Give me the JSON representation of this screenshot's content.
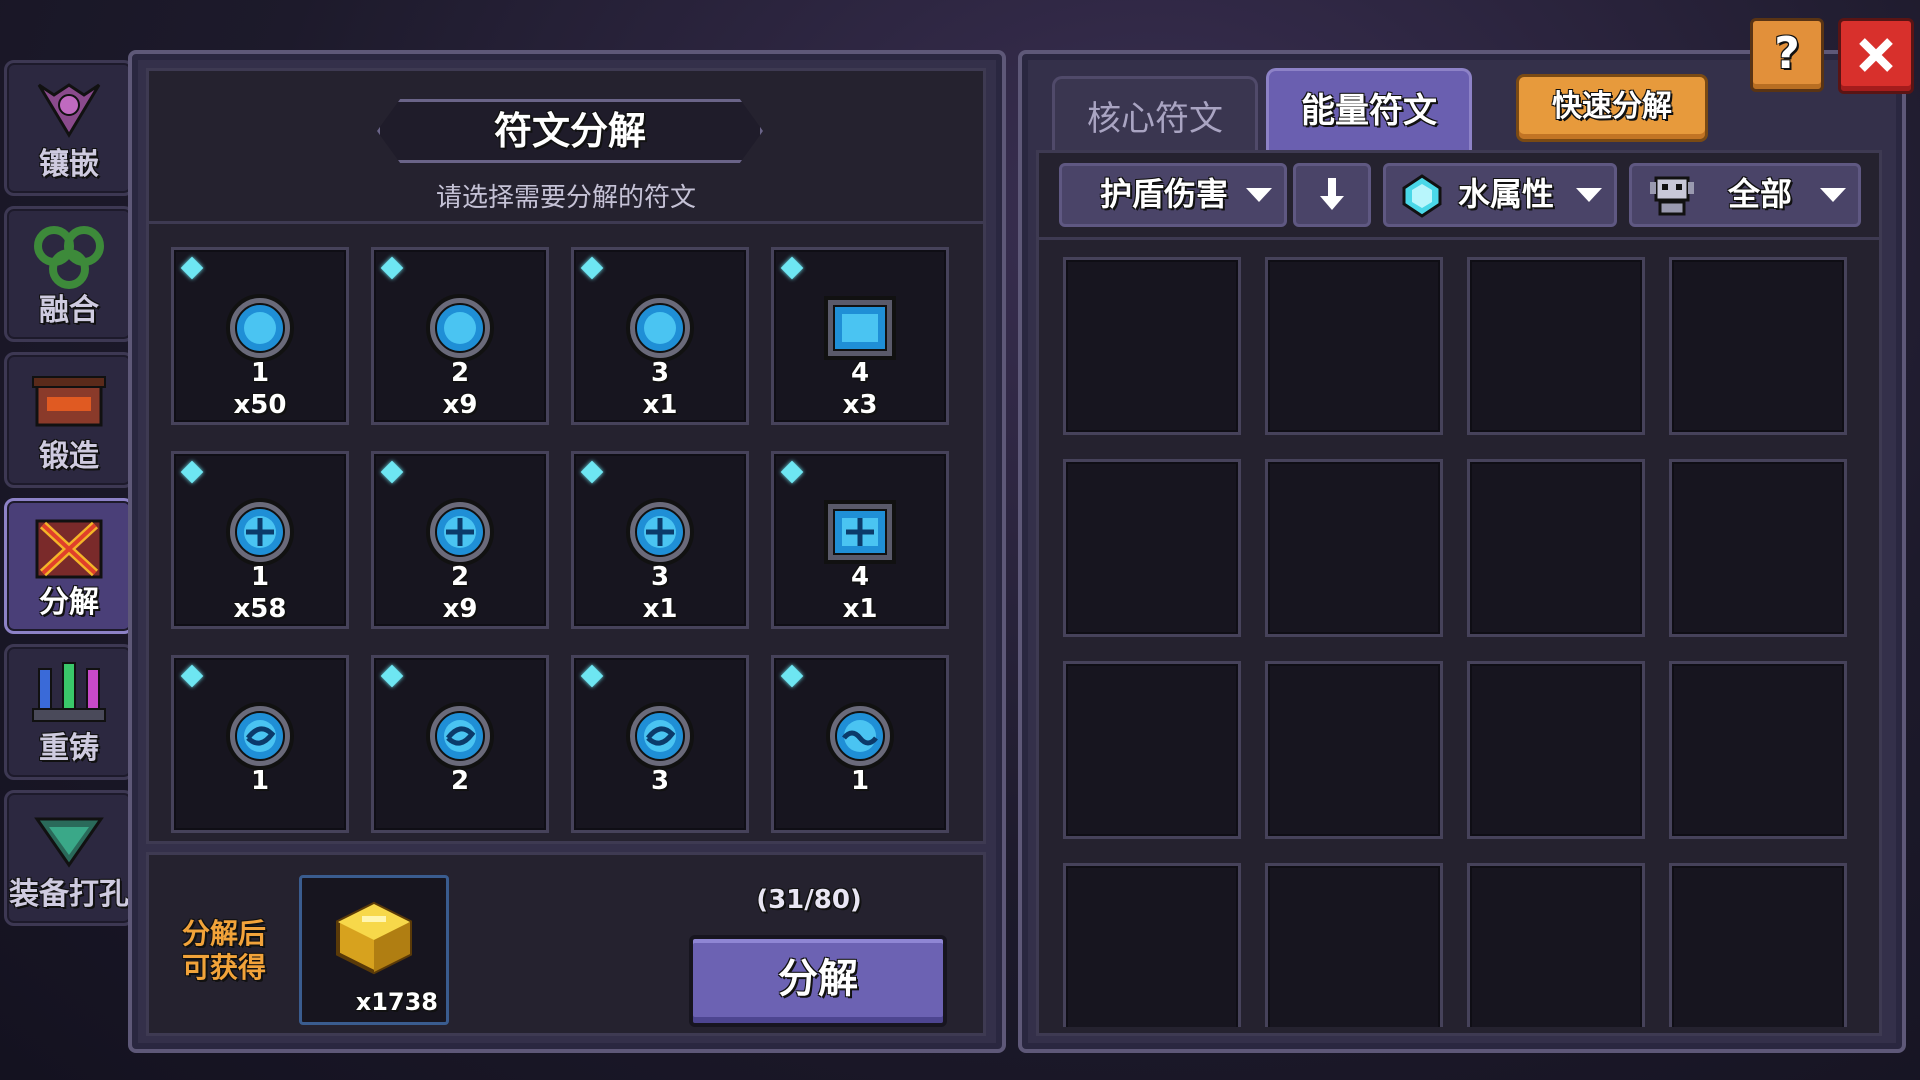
{
  "sidebar": {
    "items": [
      {
        "label": "镶嵌",
        "icon": "inlay-icon"
      },
      {
        "label": "融合",
        "icon": "fusion-icon"
      },
      {
        "label": "锻造",
        "icon": "forge-icon"
      },
      {
        "label": "分解",
        "icon": "decompose-icon",
        "active": true
      },
      {
        "label": "重铸",
        "icon": "recast-icon"
      },
      {
        "label": "装备打孔",
        "icon": "socket-icon"
      }
    ]
  },
  "left": {
    "title": "符文分解",
    "subtitle": "请选择需要分解的符文",
    "runes": [
      {
        "level": "1",
        "count": "x50",
        "shape": "round",
        "icon": "blue-rune-icon"
      },
      {
        "level": "2",
        "count": "x9",
        "shape": "round",
        "icon": "blue-rune-icon"
      },
      {
        "level": "3",
        "count": "x1",
        "shape": "round",
        "icon": "blue-rune-icon"
      },
      {
        "level": "4",
        "count": "x3",
        "shape": "square",
        "icon": "blue-rune-icon"
      },
      {
        "level": "1",
        "count": "x58",
        "shape": "round",
        "icon": "blue-cross-rune-icon"
      },
      {
        "level": "2",
        "count": "x9",
        "shape": "round",
        "icon": "blue-cross-rune-icon"
      },
      {
        "level": "3",
        "count": "x1",
        "shape": "round",
        "icon": "blue-cross-rune-icon"
      },
      {
        "level": "4",
        "count": "x1",
        "shape": "square",
        "icon": "blue-cross-rune-icon"
      },
      {
        "level": "1",
        "count": "",
        "shape": "round",
        "icon": "blue-swirl-rune-icon"
      },
      {
        "level": "2",
        "count": "",
        "shape": "round",
        "icon": "blue-swirl-rune-icon"
      },
      {
        "level": "3",
        "count": "",
        "shape": "round",
        "icon": "blue-swirl-rune-icon"
      },
      {
        "level": "1",
        "count": "",
        "shape": "round",
        "icon": "blue-wave-rune-icon"
      }
    ],
    "reward_label_line1": "分解后",
    "reward_label_line2": "可获得",
    "reward_count": "x1738",
    "reward_icon": "gold-cube-icon",
    "capacity": "(31/80)",
    "decompose_label": "分解"
  },
  "right": {
    "tabs": [
      {
        "label": "核心符文",
        "active": false
      },
      {
        "label": "能量符文",
        "active": true
      }
    ],
    "quick_label": "快速分解",
    "filters": {
      "stat": "护盾伤害",
      "sort_icon": "arrow-down-icon",
      "element": "水属性",
      "element_icon": "water-gem-icon",
      "category": "全部",
      "category_icon": "robot-icon"
    },
    "empty_slots": 16
  },
  "colors": {
    "accent_purple": "#6c62b3",
    "orange": "#e79a3c",
    "red": "#d8302c",
    "rune_cyan": "#6ee6f2"
  }
}
